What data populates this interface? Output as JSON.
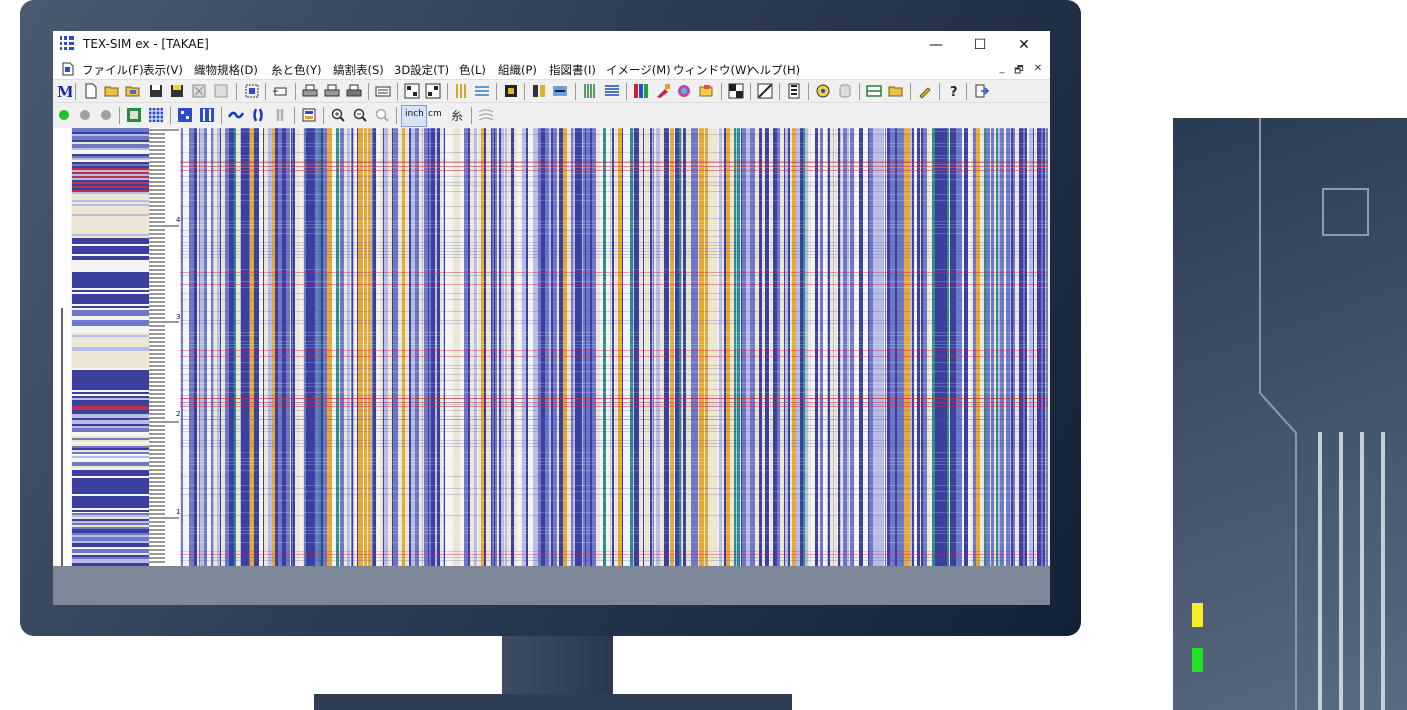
{
  "window": {
    "title": "TEX-SIM ex - [TAKAE]",
    "controls": {
      "minimize": "—",
      "maximize": "☐",
      "close": "✕"
    }
  },
  "menu": [
    {
      "label": "ファイル(F)"
    },
    {
      "label": "表示(V)"
    },
    {
      "label": "織物規格(D)"
    },
    {
      "label": "糸と色(Y)"
    },
    {
      "label": "縞割表(S)"
    },
    {
      "label": "3D設定(T)"
    },
    {
      "label": "色(L)"
    },
    {
      "label": "組織(P)"
    },
    {
      "label": "指図書(I)"
    },
    {
      "label": "イメージ(M)"
    },
    {
      "label": "ウィンドウ(W)"
    },
    {
      "label": "ヘルプ(H)"
    }
  ],
  "mdi_controls": {
    "minimize": "_",
    "restore": "🗗",
    "close": "✕"
  },
  "toolbar2": {
    "inch_label": "inch",
    "cm_label": "cm",
    "yarn_label": "糸"
  },
  "ruler": {
    "labels": [
      "4",
      "3",
      "2",
      "1"
    ]
  },
  "colors": {
    "navy": "#3b3f9e",
    "blue": "#6f78c6",
    "lavender": "#b8bde6",
    "cream": "#ece6d2",
    "gold": "#e6a934",
    "teal": "#2a8e8a",
    "red": "#b83350",
    "white": "#f4f4f4"
  }
}
